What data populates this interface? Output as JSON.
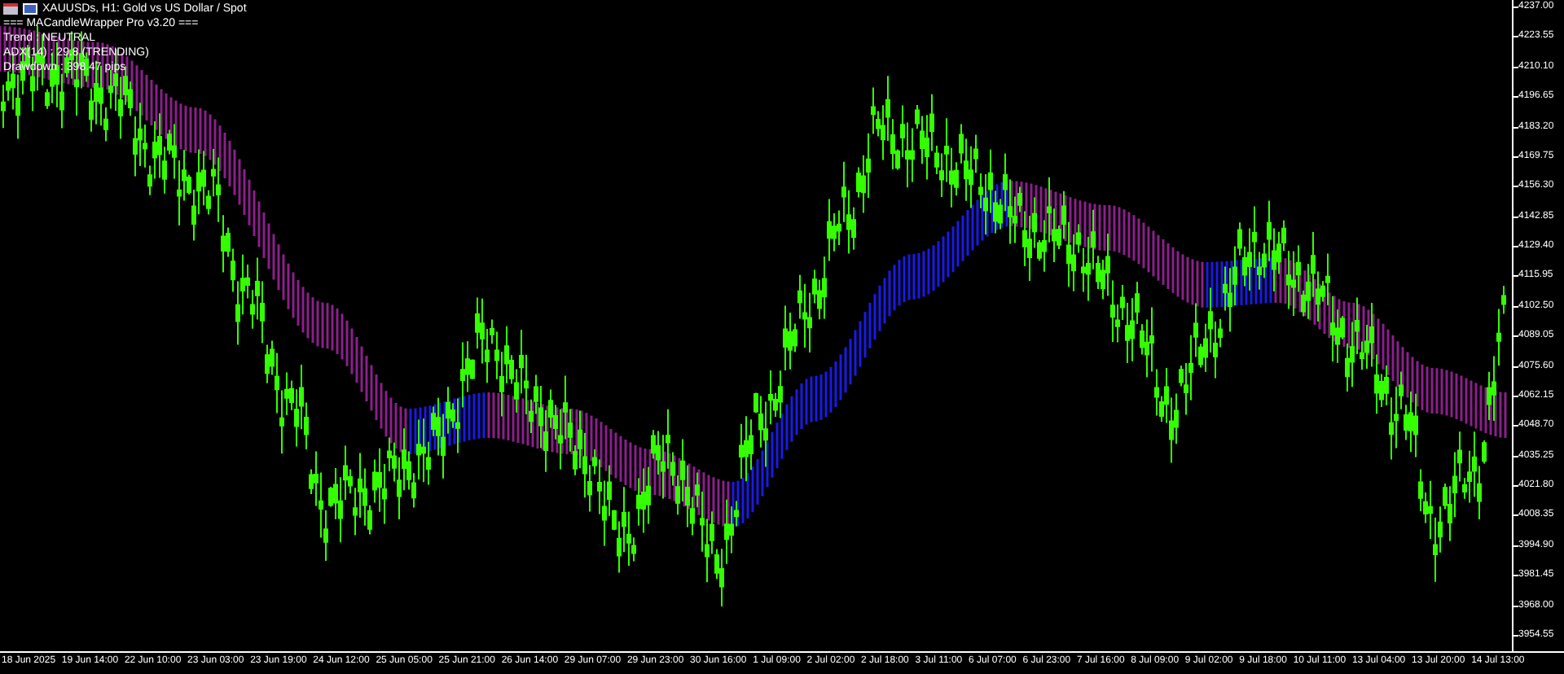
{
  "chart": {
    "symbol_line": "XAUUSDs, H1:  Gold vs US Dollar / Spot",
    "indicator_lines": [
      "=== MACandleWrapper Pro v3.20 ===",
      "Trend : NEUTRAL",
      "ADX(14) : 29.8 (TRENDING)",
      "Drawdown : 398.47 pips"
    ],
    "price_axis": [
      "4237.00",
      "4223.55",
      "4210.10",
      "4196.65",
      "4183.20",
      "4169.75",
      "4156.30",
      "4142.85",
      "4129.40",
      "4115.95",
      "4102.50",
      "4089.05",
      "4075.60",
      "4062.15",
      "4048.70",
      "4035.25",
      "4021.80",
      "4008.35",
      "3994.90",
      "3981.45",
      "3968.00",
      "3954.55"
    ],
    "time_axis": [
      "18 Jun 2025",
      "19 Jun 14:00",
      "22 Jun 10:00",
      "23 Jun 03:00",
      "23 Jun 19:00",
      "24 Jun 12:00",
      "25 Jun 05:00",
      "25 Jun 21:00",
      "26 Jun 14:00",
      "29 Jun 07:00",
      "29 Jun 23:00",
      "30 Jun 16:00",
      "1 Jul 09:00",
      "2 Jul 02:00",
      "2 Jul 18:00",
      "3 Jul 11:00",
      "6 Jul 07:00",
      "6 Jul 23:00",
      "7 Jul 16:00",
      "8 Jul 09:00",
      "9 Jul 02:00",
      "9 Jul 18:00",
      "10 Jul 11:00",
      "13 Jul 04:00",
      "13 Jul 20:00",
      "14 Jul 13:00"
    ]
  }
}
